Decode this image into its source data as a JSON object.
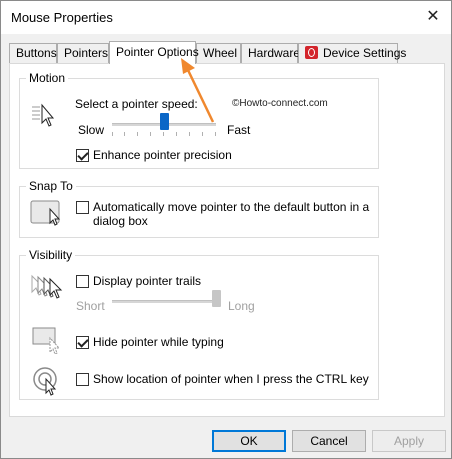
{
  "window": {
    "title": "Mouse Properties"
  },
  "tabs": [
    {
      "label": "Buttons"
    },
    {
      "label": "Pointers"
    },
    {
      "label": "Pointer Options"
    },
    {
      "label": "Wheel"
    },
    {
      "label": "Hardware"
    },
    {
      "label": "Device Settings"
    }
  ],
  "motion": {
    "title": "Motion",
    "speed_label": "Select a pointer speed:",
    "slow_label": "Slow",
    "fast_label": "Fast",
    "speed_value_fraction": 0.5,
    "enhance_label": "Enhance pointer precision",
    "enhance_checked": true
  },
  "snap": {
    "title": "Snap To",
    "label_line1": "Automatically move pointer to the default button in a",
    "label_line2": "dialog box",
    "checked": false
  },
  "visibility": {
    "title": "Visibility",
    "trails_label": "Display pointer trails",
    "trails_checked": false,
    "short_label": "Short",
    "long_label": "Long",
    "trails_length_fraction": 1.0,
    "hide_label": "Hide pointer while typing",
    "hide_checked": true,
    "ctrl_label": "Show location of pointer when I press the CTRL key",
    "ctrl_checked": false
  },
  "watermark": "©Howto-connect.com",
  "buttons": {
    "ok": "OK",
    "cancel": "Cancel",
    "apply": "Apply"
  },
  "colors": {
    "accent": "#0078d7",
    "annotation_arrow": "#f0882e",
    "device_icon": "#d3242b"
  }
}
